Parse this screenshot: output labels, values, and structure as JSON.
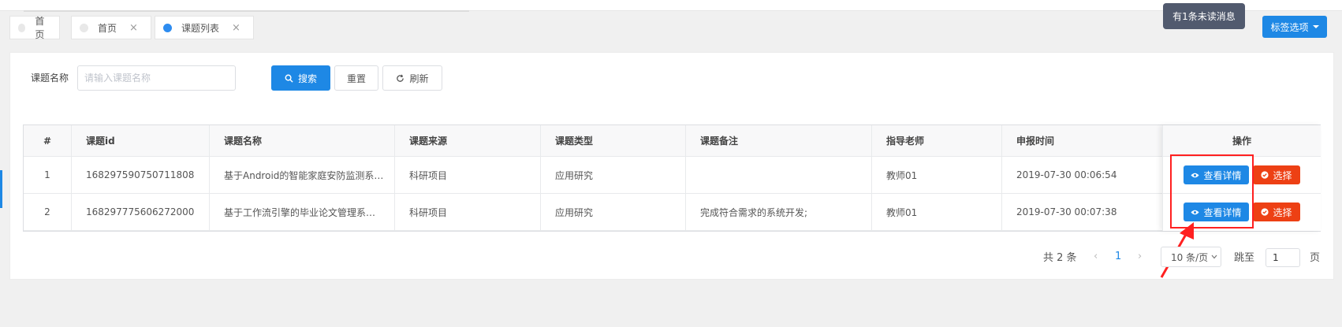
{
  "tabs": [
    {
      "label": "首页",
      "closable": false,
      "active": false
    },
    {
      "label": "首页",
      "closable": true,
      "active": false
    },
    {
      "label": "课题列表",
      "closable": true,
      "active": true
    }
  ],
  "close_glyph": "×",
  "notification": {
    "text": "有1条未读消息"
  },
  "tag_options": {
    "label": "标签选项"
  },
  "search": {
    "label": "课题名称",
    "placeholder": "请输入课题名称",
    "search_label": "搜索",
    "reset_label": "重置",
    "refresh_label": "刷新"
  },
  "table": {
    "columns": [
      "#",
      "课题id",
      "课题名称",
      "课题来源",
      "课题类型",
      "课题备注",
      "指导老师",
      "申报时间",
      "操作"
    ],
    "rows": [
      {
        "index": "1",
        "id": "168297590750711808",
        "name": "基于Android的智能家庭安防监测系…",
        "source": "科研项目",
        "type": "应用研究",
        "remark": "",
        "teacher": "教师01",
        "time": "2019-07-30 00:06:54"
      },
      {
        "index": "2",
        "id": "168297775606272000",
        "name": "基于工作流引擎的毕业论文管理系…",
        "source": "科研项目",
        "type": "应用研究",
        "remark": "完成符合需求的系统开发;",
        "teacher": "教师01",
        "time": "2019-07-30 00:07:38"
      }
    ],
    "view_label": "查看详情",
    "select_label": "选择"
  },
  "pagination": {
    "total_text": "共 2 条",
    "current_page": "1",
    "page_size_text": "10 条/页",
    "jump_label": "跳至",
    "jump_value": "1",
    "page_unit": "页",
    "prev_glyph": "‹",
    "next_glyph": "›"
  },
  "colors": {
    "primary": "#1e88e5",
    "danger": "#ed4014",
    "annotation": "#ff2020"
  },
  "icons": [
    "search-icon",
    "refresh-icon",
    "eye-icon",
    "check-circle-icon",
    "chevron-down-icon",
    "caret-down-icon",
    "arrow-annotation"
  ]
}
